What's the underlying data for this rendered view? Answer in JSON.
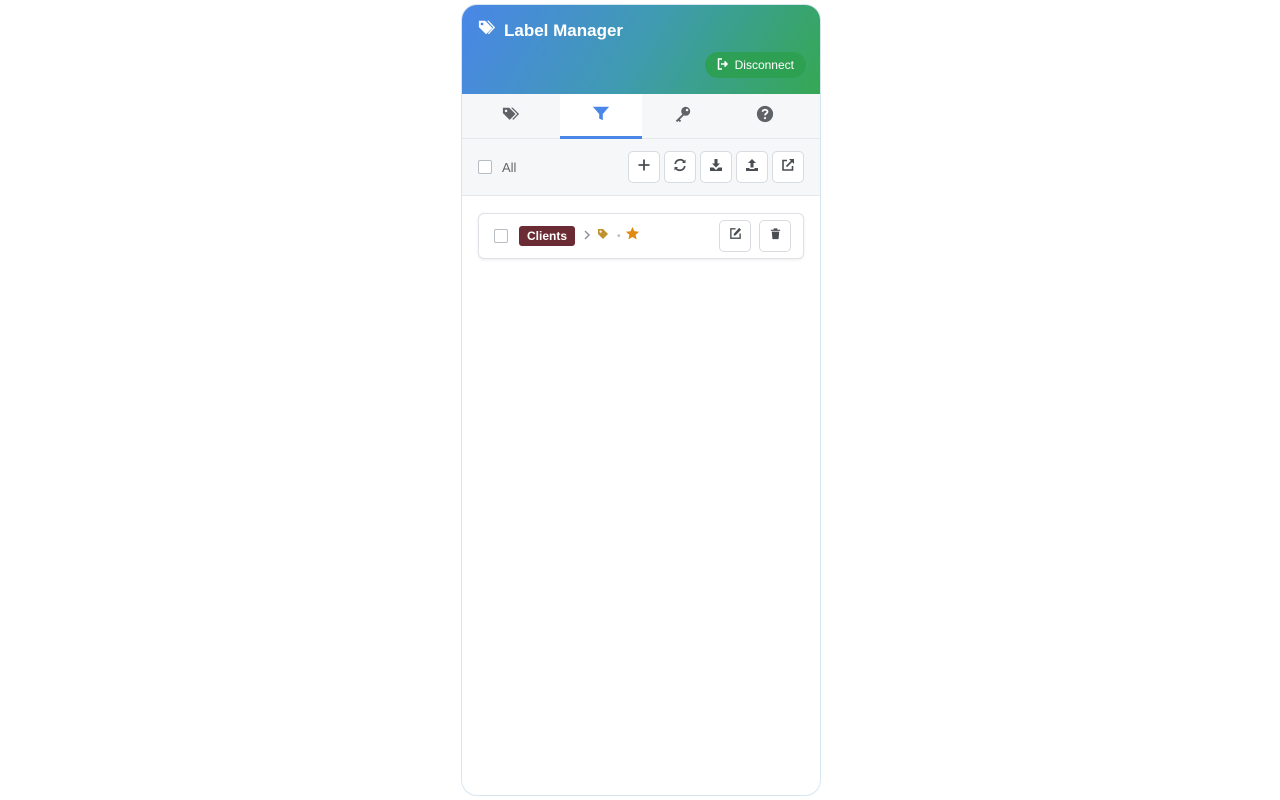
{
  "app": {
    "title": "Label Manager",
    "disconnect_label": "Disconnect"
  },
  "tabs": [
    {
      "icon": "tags-icon",
      "active": false
    },
    {
      "icon": "filter-icon",
      "active": true
    },
    {
      "icon": "key-icon",
      "active": false
    },
    {
      "icon": "help-icon",
      "active": false
    }
  ],
  "toolbar": {
    "select_all_label": "All",
    "buttons": [
      "plus-icon",
      "refresh-icon",
      "download-icon",
      "upload-icon",
      "external-link-icon"
    ]
  },
  "filters": [
    {
      "label": "Clients",
      "label_color": "#6b2b35",
      "action_icons": [
        "tag-icon",
        "star-icon"
      ]
    }
  ],
  "colors": {
    "header_start": "#4a86e8",
    "header_end": "#35a853",
    "accent": "#4a86e8",
    "tag_icon": "#c0922e",
    "star_icon": "#e08a10"
  }
}
